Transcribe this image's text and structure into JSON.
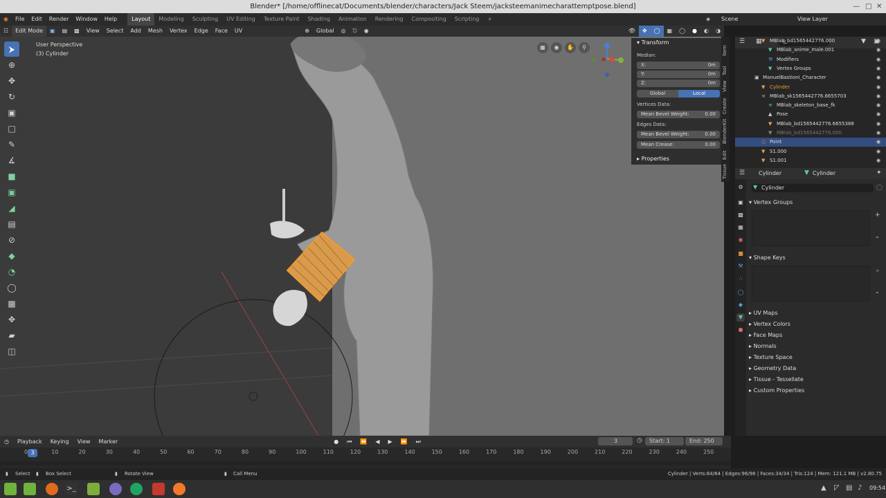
{
  "window": {
    "title": "Blender* [/home/offlinecat/Documents/blender/characters/Jack Steem/jacksteemanimecharattemptpose.blend]"
  },
  "menubar": {
    "menus": [
      "File",
      "Edit",
      "Render",
      "Window",
      "Help"
    ],
    "workspaces": [
      "Layout",
      "Modeling",
      "Sculpting",
      "UV Editing",
      "Texture Paint",
      "Shading",
      "Animation",
      "Rendering",
      "Compositing",
      "Scripting"
    ],
    "active_workspace": "Layout",
    "scene": "Scene",
    "view_layer": "View Layer"
  },
  "viewport_header": {
    "mode": "Edit Mode",
    "menus": [
      "View",
      "Select",
      "Add",
      "Mesh",
      "Vertex",
      "Edge",
      "Face",
      "UV"
    ],
    "orientation": "Global"
  },
  "viewport": {
    "view_name": "User Perspective",
    "object_label": "(3) Cylinder"
  },
  "transform_panel": {
    "title": "Transform",
    "median_label": "Median:",
    "x_label": "X:",
    "x_value": "0m",
    "y_label": "Y:",
    "y_value": "0m",
    "z_label": "Z:",
    "z_value": "0m",
    "global_label": "Global",
    "local_label": "Local",
    "vertices_data_label": "Vertices Data:",
    "vertex_bevel_label": "Mean Bevel Weight:",
    "vertex_bevel_value": "0.00",
    "edges_data_label": "Edges Data:",
    "edge_bevel_label": "Mean Bevel Weight:",
    "edge_bevel_value": "0.00",
    "crease_label": "Mean Crease:",
    "crease_value": "0.00",
    "properties_label": "Properties"
  },
  "sidebar_tabs": [
    "Item",
    "Tool",
    "View",
    "Create",
    "BlenderKit",
    "Edit",
    "Tissue"
  ],
  "outliner": {
    "rows": [
      {
        "label": "MBlab_bd1565442776.000",
        "indent": 2
      },
      {
        "label": "MBlab_anime_male.001",
        "indent": 3
      },
      {
        "label": "Modifiers",
        "indent": 3
      },
      {
        "label": "Vertex Groups",
        "indent": 3
      },
      {
        "label": "ManuelBastioni_Character",
        "indent": 1
      },
      {
        "label": "Cylinder",
        "indent": 2
      },
      {
        "label": "MBlab_sk1565442776.6655703",
        "indent": 2
      },
      {
        "label": "MBlab_skeleton_base_fk",
        "indent": 3
      },
      {
        "label": "Pose",
        "indent": 3
      },
      {
        "label": "MBlab_bd1565442776.6655388",
        "indent": 3
      },
      {
        "label": "MBlab_bd1565442776.000",
        "indent": 3
      },
      {
        "label": "Point",
        "indent": 2
      },
      {
        "label": "S1.000",
        "indent": 2
      },
      {
        "label": "S1.001",
        "indent": 2
      }
    ]
  },
  "properties": {
    "breadcrumb_object": "Cylinder",
    "breadcrumb_data": "Cylinder",
    "data_name": "Cylinder",
    "sections": {
      "vertex_groups": "Vertex Groups",
      "shape_keys": "Shape Keys",
      "uv_maps": "UV Maps",
      "vertex_colors": "Vertex Colors",
      "face_maps": "Face Maps",
      "normals": "Normals",
      "texture_space": "Texture Space",
      "geometry_data": "Geometry Data",
      "tissue": "Tissue - Tessellate",
      "custom_properties": "Custom Properties"
    }
  },
  "timeline": {
    "menus": [
      "Playback",
      "Keying",
      "View",
      "Marker"
    ],
    "current_frame": "3",
    "start_label": "Start:",
    "start_value": "1",
    "end_label": "End:",
    "end_value": "250",
    "ticks": [
      "0",
      "10",
      "20",
      "30",
      "40",
      "50",
      "60",
      "70",
      "80",
      "90",
      "100",
      "110",
      "120",
      "130",
      "140",
      "150",
      "160",
      "170",
      "180",
      "190",
      "200",
      "210",
      "220",
      "230",
      "240",
      "250"
    ],
    "frame_marker": "3"
  },
  "statusbar": {
    "select": "Select",
    "box_select": "Box Select",
    "rotate_view": "Rotate View",
    "call_menu": "Call Menu",
    "stats": "Cylinder | Verts:64/64 | Edges:96/96 | Faces:34/34 | Tris:124 | Mem: 121.1 MB | v2.80.75"
  },
  "taskbar": {
    "time": "09:54"
  },
  "colors": {
    "accent": "#4772b3",
    "selection_orange": "#f29b30",
    "outliner_selected": "#334d80"
  }
}
